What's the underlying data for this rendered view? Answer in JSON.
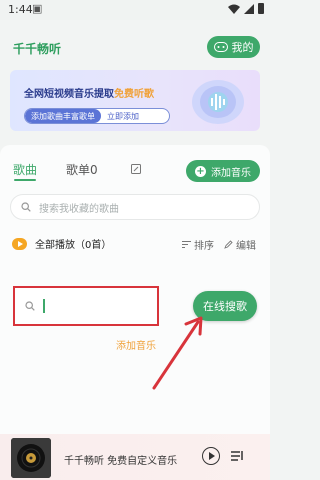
{
  "status_bar": {
    "time": "1:44",
    "notif": "▣"
  },
  "header": {
    "app_title": "千千畅听",
    "mine_label": "我的"
  },
  "banner": {
    "title_main": "全网短视频音乐提取",
    "title_accent": "免费听歌",
    "sub_text": "添加歌曲丰富歌单",
    "sub_action": "立即添加"
  },
  "tabs": {
    "song": "歌曲",
    "playlist": "歌单0"
  },
  "add_music_button": "添加音乐",
  "search": {
    "placeholder": "搜索我收藏的歌曲"
  },
  "list_toolbar": {
    "play_all": "全部播放（0首）",
    "sort": "排序",
    "edit": "编辑"
  },
  "local_search": {
    "value": ""
  },
  "online_search_button": "在线搜歌",
  "add_music_link": "添加音乐",
  "player": {
    "text": "千千畅听 免费自定义音乐"
  },
  "colors": {
    "accent": "#3ea86a",
    "highlight": "#d8343b",
    "orange": "#f0a23b"
  }
}
